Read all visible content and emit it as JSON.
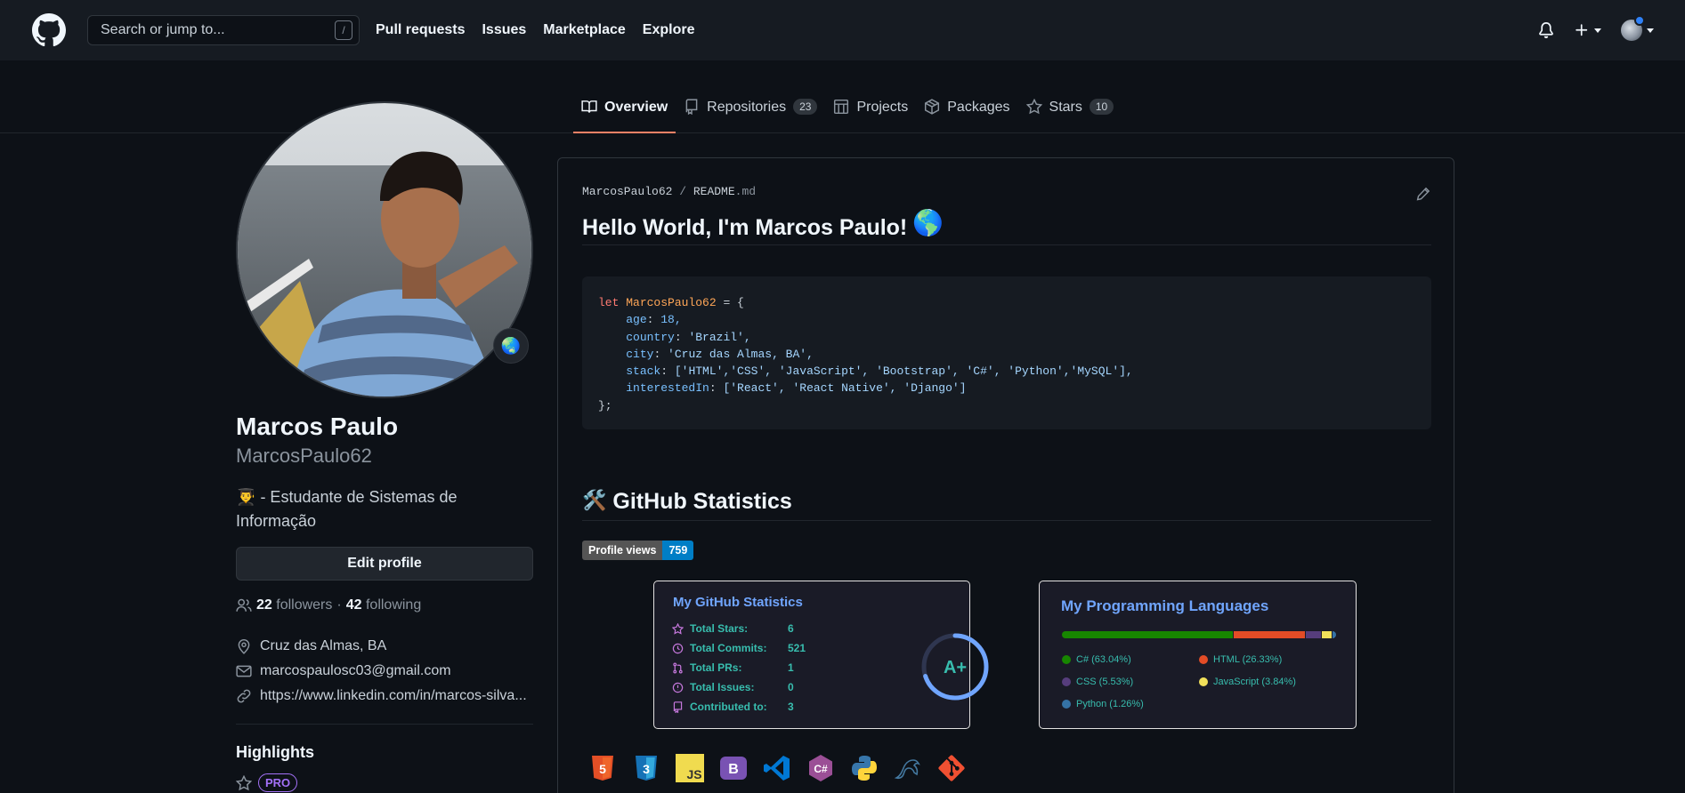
{
  "header": {
    "search_placeholder": "Search or jump to...",
    "slash": "/",
    "nav": [
      "Pull requests",
      "Issues",
      "Marketplace",
      "Explore"
    ]
  },
  "tabs": [
    {
      "label": "Overview",
      "count": null,
      "selected": true
    },
    {
      "label": "Repositories",
      "count": "23"
    },
    {
      "label": "Projects",
      "count": null
    },
    {
      "label": "Packages",
      "count": null
    },
    {
      "label": "Stars",
      "count": "10"
    }
  ],
  "profile": {
    "name": "Marcos Paulo",
    "login": "MarcosPaulo62",
    "bio": "- Estudante de Sistemas de Informação",
    "bio_emoji": "👨‍🎓",
    "status_emoji": "🌏",
    "edit_label": "Edit profile",
    "followers": "22",
    "followers_label": "followers",
    "following": "42",
    "following_label": "following",
    "location": "Cruz das Almas, BA",
    "email": "marcospaulosc03@gmail.com",
    "website": "https://www.linkedin.com/in/marcos-silva...",
    "highlights": "Highlights",
    "pro": "PRO"
  },
  "readme": {
    "owner": "MarcosPaulo62",
    "file": "README",
    "ext": ".md",
    "heading": "Hello World, I'm Marcos Paulo!",
    "heading_emoji": "🌎",
    "code": {
      "kw": "let",
      "var": "MarcosPaulo62",
      "open": " = {",
      "lines": [
        {
          "prop": "age",
          "val": "18,",
          "type": "num"
        },
        {
          "prop": "country",
          "val": "'Brazil',",
          "type": "str"
        },
        {
          "prop": "city",
          "val": "'Cruz das Almas, BA',",
          "type": "str"
        },
        {
          "prop": "stack",
          "val": "['HTML','CSS', 'JavaScript', 'Bootstrap', 'C#', 'Python','MySQL'],",
          "type": "str"
        },
        {
          "prop": "interestedIn",
          "val": "['React', 'React Native', 'Django']",
          "type": "str"
        }
      ],
      "close": "};"
    },
    "stats_heading": "GitHub Statistics",
    "stats_emoji": "🛠️",
    "views_label": "Profile views",
    "views_value": "759"
  },
  "stats_card": {
    "title": "My GitHub Statistics",
    "rows": [
      {
        "label": "Total Stars:",
        "value": "6"
      },
      {
        "label": "Total Commits:",
        "value": "521"
      },
      {
        "label": "Total PRs:",
        "value": "1"
      },
      {
        "label": "Total Issues:",
        "value": "0"
      },
      {
        "label": "Contributed to:",
        "value": "3"
      }
    ],
    "grade": "A+",
    "grade_progress": 0.7
  },
  "langs_card": {
    "title": "My Programming Languages",
    "items": [
      {
        "label": "C# (63.04%)",
        "pct": 63.04,
        "color": "#178600"
      },
      {
        "label": "HTML (26.33%)",
        "pct": 26.33,
        "color": "#e34c26"
      },
      {
        "label": "CSS (5.53%)",
        "pct": 5.53,
        "color": "#563d7c"
      },
      {
        "label": "JavaScript (3.84%)",
        "pct": 3.84,
        "color": "#f1e05a"
      },
      {
        "label": "Python (1.26%)",
        "pct": 1.26,
        "color": "#3572a5"
      }
    ]
  },
  "tech_icons": [
    "html5-icon",
    "css3-icon",
    "javascript-icon",
    "bootstrap-icon",
    "vscode-icon",
    "csharp-icon",
    "python-icon",
    "mysql-icon",
    "git-icon"
  ],
  "tech_labels": {
    "html": "5",
    "css": "3",
    "js": "JS",
    "bootstrap": "B",
    "csharp": "C#"
  }
}
